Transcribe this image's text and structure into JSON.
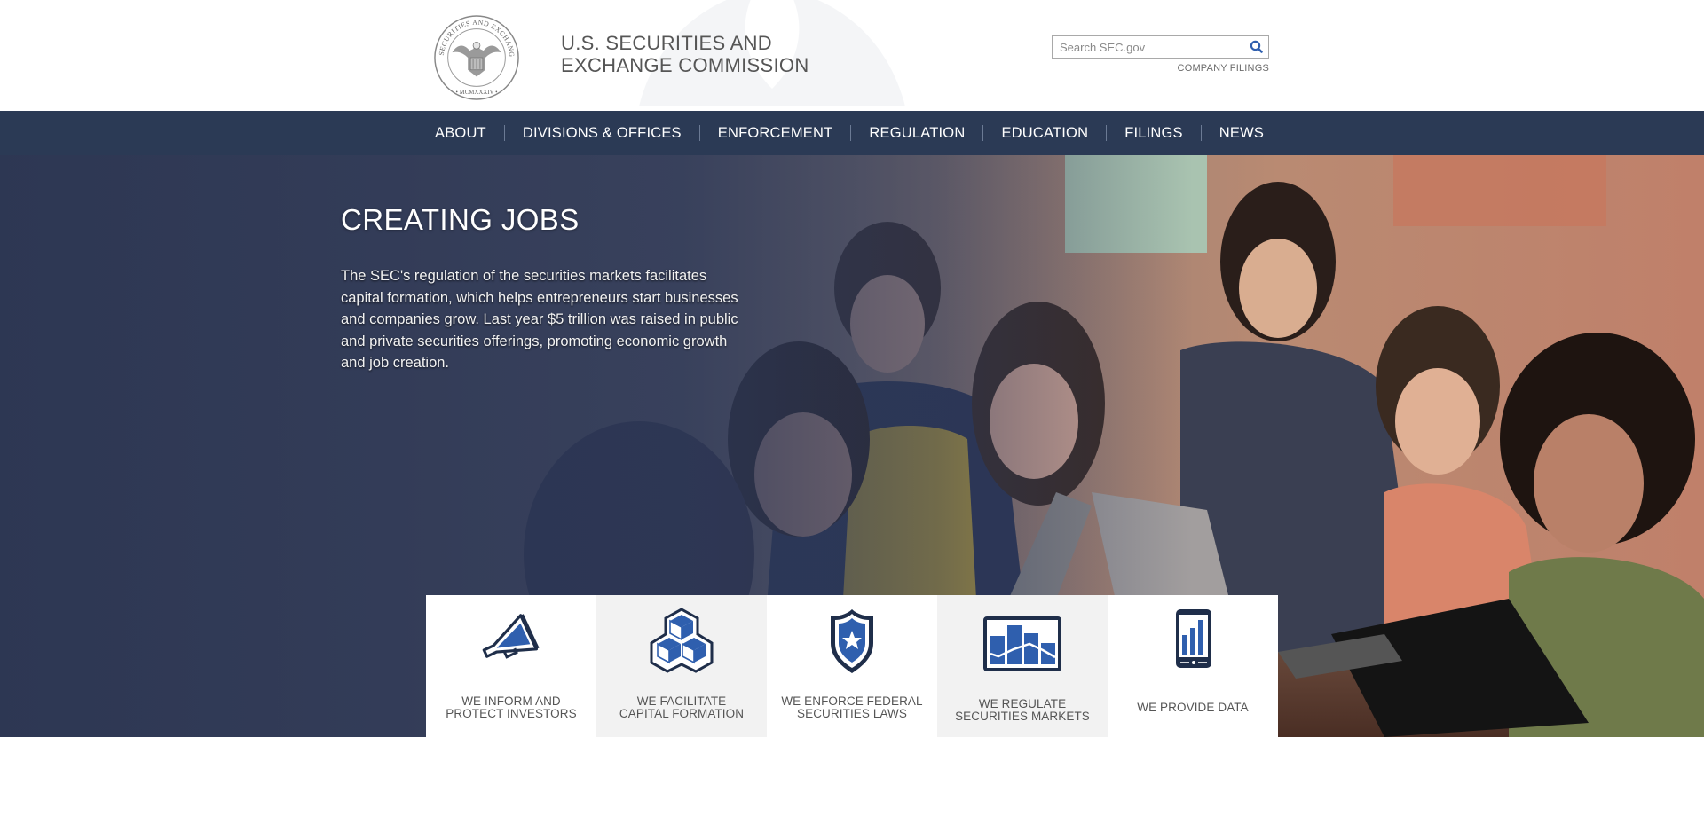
{
  "header": {
    "seal_alt": "U.S. Securities and Exchange Commission seal",
    "agency_name_line1": "U.S. SECURITIES AND",
    "agency_name_line2": "EXCHANGE COMMISSION",
    "search": {
      "placeholder": "Search SEC.gov",
      "value": "",
      "button_icon": "search-icon"
    },
    "company_filings_link": "COMPANY FILINGS"
  },
  "nav": {
    "items": [
      {
        "label": "ABOUT"
      },
      {
        "label": "DIVISIONS & OFFICES"
      },
      {
        "label": "ENFORCEMENT"
      },
      {
        "label": "REGULATION"
      },
      {
        "label": "EDUCATION"
      },
      {
        "label": "FILINGS"
      },
      {
        "label": "NEWS"
      }
    ]
  },
  "hero": {
    "title": "CREATING JOBS",
    "body": "The SEC's regulation of the securities markets facilitates capital formation, which helps entrepreneurs start businesses and companies grow. Last year $5 trillion was raised in public and private securities offerings, promoting economic growth and job creation.",
    "image_description": "Group of young people smiling around laptops and tablets"
  },
  "mission_cards": [
    {
      "icon": "megaphone-icon",
      "line1": "WE INFORM AND",
      "line2": "PROTECT INVESTORS"
    },
    {
      "icon": "cubes-icon",
      "line1": "WE FACILITATE",
      "line2": "CAPITAL FORMATION"
    },
    {
      "icon": "shield-star-icon",
      "line1": "WE ENFORCE FEDERAL",
      "line2": "SECURITIES LAWS"
    },
    {
      "icon": "bar-chart-icon",
      "line1": "WE REGULATE",
      "line2": "SECURITIES MARKETS"
    },
    {
      "icon": "mobile-data-icon",
      "line1": "WE PROVIDE DATA",
      "line2": ""
    }
  ],
  "colors": {
    "nav_bg": "#2b3a55",
    "icon_blue": "#2f5fae",
    "icon_navy": "#1f2e4a",
    "card_text": "#555555",
    "card_alt_bg": "#f2f2f2"
  }
}
